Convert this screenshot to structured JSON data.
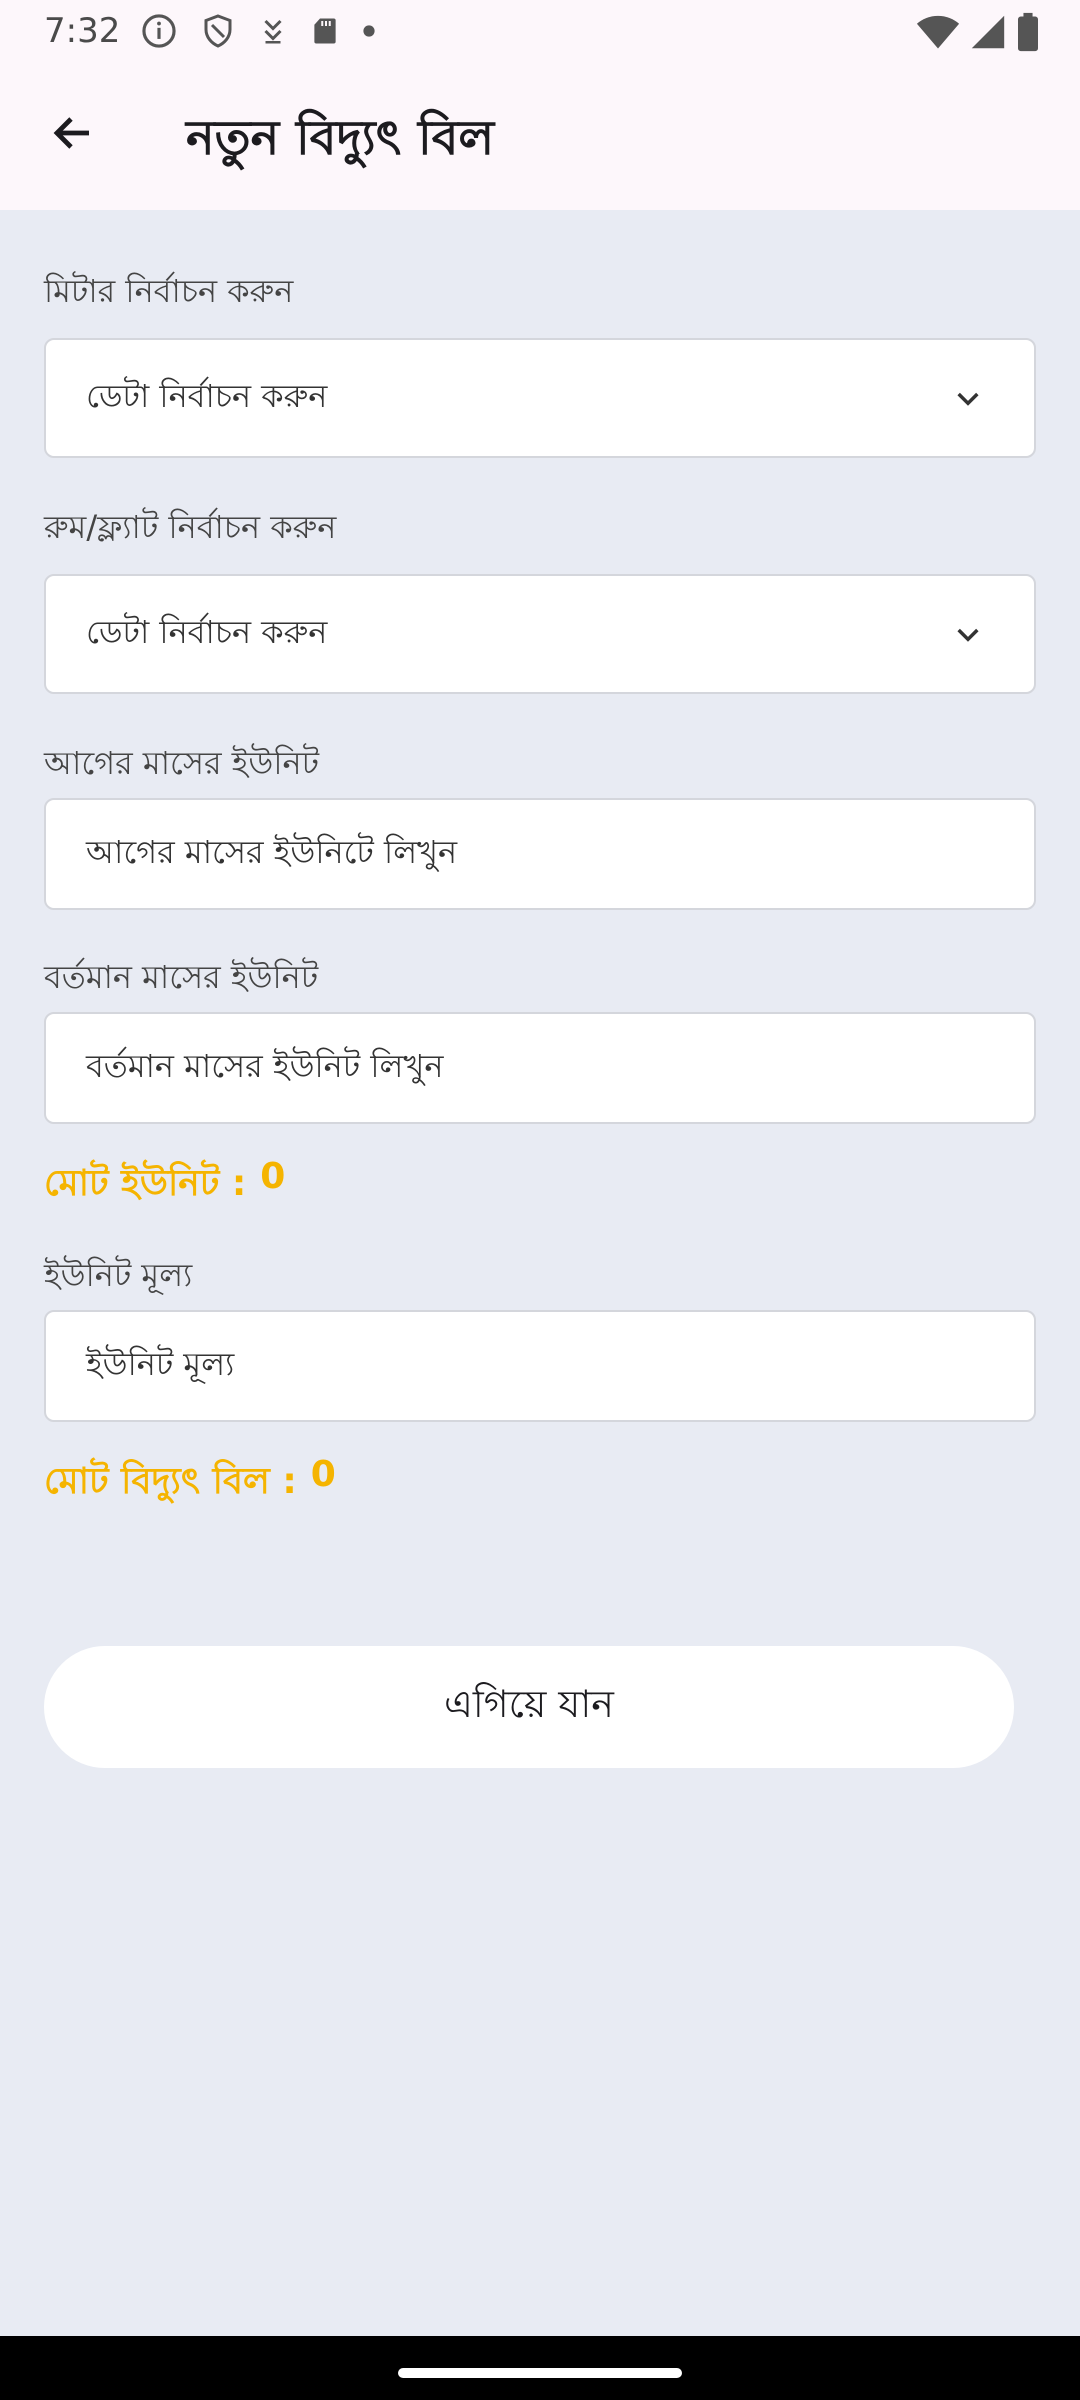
{
  "status_bar": {
    "time": "7:32",
    "left_icons": [
      "info-icon",
      "shield-icon",
      "download-icon",
      "sd-card-icon",
      "dot-icon"
    ],
    "right_icons": [
      "wifi-icon",
      "signal-icon",
      "battery-icon"
    ]
  },
  "app_bar": {
    "back_icon": "arrow-back-icon",
    "title": "নতুন বিদ্যুৎ বিল"
  },
  "form": {
    "meter": {
      "label": "মিটার নির্বাচন করুন",
      "value": "ডেটা নির্বাচন করুন"
    },
    "room": {
      "label": "রুম/ফ্ল্যাট নির্বাচন করুন",
      "value": "ডেটা নির্বাচন করুন"
    },
    "previous_unit": {
      "label": "আগের মাসের ইউনিট",
      "placeholder": "আগের মাসের ইউনিটে লিখুন"
    },
    "current_unit": {
      "label": "বর্তমান মাসের ইউনিট",
      "placeholder": "বর্তমান মাসের ইউনিট লিখুন"
    },
    "total_unit": {
      "label": "মোট ইউনিট :",
      "value": "0"
    },
    "unit_price": {
      "label": "ইউনিট মূল্য",
      "placeholder": "ইউনিট মূল্য"
    },
    "total_bill": {
      "label": "মোট বিদ্যুৎ বিল :",
      "value": "0"
    },
    "submit_label": "এগিয়ে যান"
  },
  "colors": {
    "accent_total": "#f5b400",
    "background": "#e8ebf3",
    "app_bar": "#fdf7fb"
  }
}
